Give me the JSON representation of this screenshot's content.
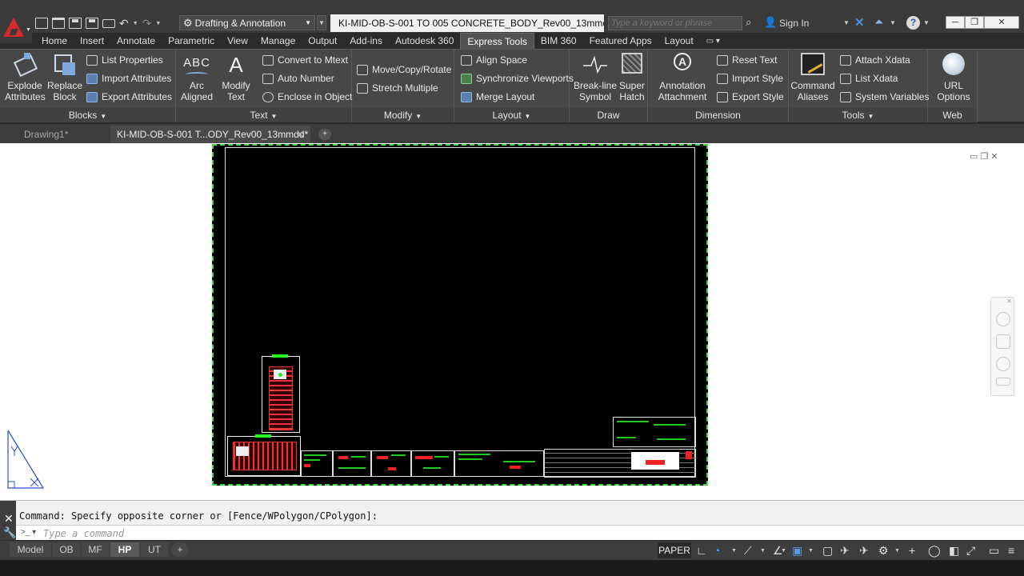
{
  "title_bar": {
    "workspace": "Drafting & Annotation",
    "document_title": "KI-MID-OB-S-001 TO 005 CONCRETE_BODY_Rev00_13mmdd.d...",
    "search_placeholder": "Type a keyword or phrase",
    "sign_in": "Sign In"
  },
  "ribbon_tabs": [
    "Home",
    "Insert",
    "Annotate",
    "Parametric",
    "View",
    "Manage",
    "Output",
    "Add-ins",
    "Autodesk 360",
    "Express Tools",
    "BIM 360",
    "Featured Apps",
    "Layout"
  ],
  "active_tab": "Express Tools",
  "panels": {
    "blocks": {
      "title": "Blocks",
      "big": [
        {
          "label": "Explode\nAttributes"
        },
        {
          "label": "Replace\nBlock"
        }
      ],
      "small": [
        "List Properties",
        "Import Attributes",
        "Export Attributes"
      ]
    },
    "text": {
      "title": "Text",
      "big": [
        {
          "label": "Arc\nAligned"
        },
        {
          "label": "Modify\nText"
        }
      ],
      "small": [
        "Convert to Mtext",
        "Auto Number",
        "Enclose in Object"
      ]
    },
    "modify": {
      "title": "Modify",
      "small": [
        "Move/Copy/Rotate",
        "Stretch Multiple"
      ]
    },
    "layout": {
      "title": "Layout",
      "small": [
        "Align Space",
        "Synchronize Viewports",
        "Merge Layout"
      ]
    },
    "draw": {
      "title": "Draw",
      "big": [
        {
          "label": "Break-line\nSymbol"
        },
        {
          "label": "Super\nHatch"
        }
      ]
    },
    "dimension": {
      "title": "Dimension",
      "big": [
        {
          "label": "Annotation\nAttachment"
        }
      ],
      "small": [
        "Reset Text",
        "Import Style",
        "Export Style"
      ]
    },
    "tools": {
      "title": "Tools",
      "big": [
        {
          "label": "Command\nAliases"
        }
      ],
      "small": [
        "Attach Xdata",
        "List Xdata",
        "System Variables"
      ]
    },
    "web": {
      "title": "Web",
      "big": [
        {
          "label": "URL\nOptions"
        }
      ]
    }
  },
  "file_tabs": [
    "Drawing1*",
    "KI-MID-OB-S-001 T...ODY_Rev00_13mmdd*"
  ],
  "command_line": {
    "history": "Command: Specify opposite corner or [Fence/WPolygon/CPolygon]:",
    "placeholder": "Type a command"
  },
  "layout_tabs": [
    "Model",
    "OB",
    "MF",
    "HP",
    "UT"
  ],
  "active_layout": "HP",
  "status": {
    "paper": "PAPER"
  },
  "colors": {
    "viewport_border": "#3fdc3f",
    "hatch_red": "#e22222",
    "accent_blue": "#4a8fe0"
  }
}
